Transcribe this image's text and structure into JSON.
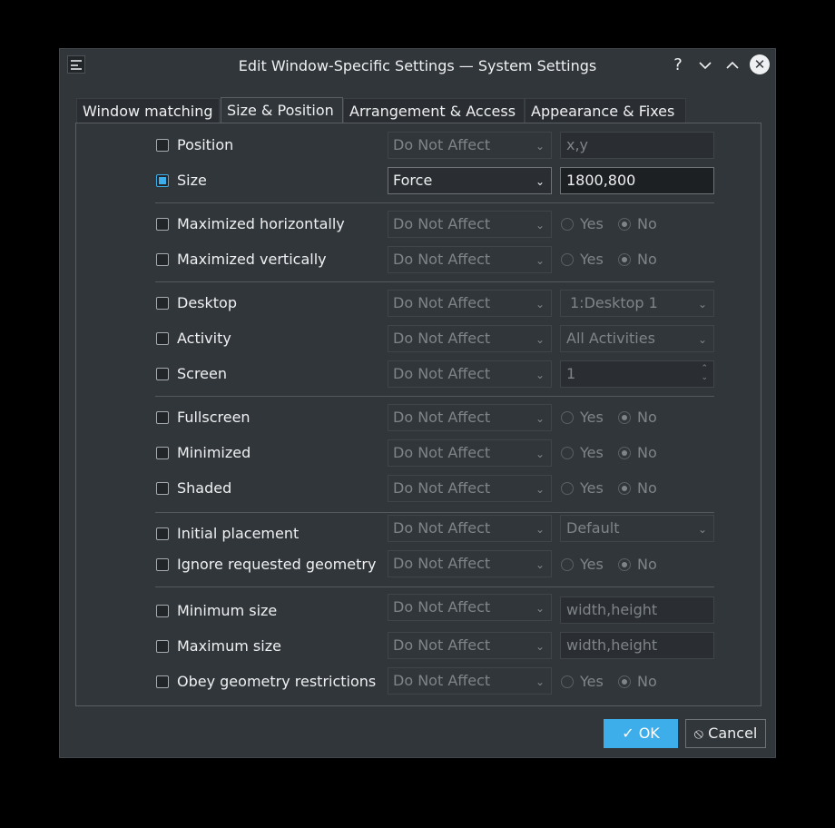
{
  "window": {
    "title": "Edit Window-Specific Settings — System Settings",
    "help_icon": "?",
    "minimize_icon": "chevron-down-icon",
    "maximize_icon": "chevron-up-icon",
    "close_icon": "close-icon"
  },
  "tabs": [
    "Window matching",
    "Size & Position",
    "Arrangement & Access",
    "Appearance & Fixes"
  ],
  "active_tab": "Size & Position",
  "rows": {
    "position": {
      "label": "Position",
      "checked": false,
      "policy": "Do Not Affect",
      "value": "x,y"
    },
    "size": {
      "label": "Size",
      "checked": true,
      "policy": "Force",
      "value": "1800,800"
    },
    "max_h": {
      "label": "Maximized horizontally",
      "checked": false,
      "policy": "Do Not Affect",
      "yes": "Yes",
      "no": "No"
    },
    "max_v": {
      "label": "Maximized vertically",
      "checked": false,
      "policy": "Do Not Affect",
      "yes": "Yes",
      "no": "No"
    },
    "desktop": {
      "label": "Desktop",
      "checked": false,
      "policy": "Do Not Affect",
      "value": "1:Desktop 1"
    },
    "activity": {
      "label": "Activity",
      "checked": false,
      "policy": "Do Not Affect",
      "value": "All Activities"
    },
    "screen": {
      "label": "Screen",
      "checked": false,
      "policy": "Do Not Affect",
      "value": "1"
    },
    "fullscreen": {
      "label": "Fullscreen",
      "checked": false,
      "policy": "Do Not Affect",
      "yes": "Yes",
      "no": "No"
    },
    "minimized": {
      "label": "Minimized",
      "checked": false,
      "policy": "Do Not Affect",
      "yes": "Yes",
      "no": "No"
    },
    "shaded": {
      "label": "Shaded",
      "checked": false,
      "policy": "Do Not Affect",
      "yes": "Yes",
      "no": "No"
    },
    "initial_placement": {
      "label": "Initial placement",
      "checked": false,
      "policy": "Do Not Affect",
      "value": "Default"
    },
    "ignore_geom": {
      "label": "Ignore requested geometry",
      "checked": false,
      "policy": "Do Not Affect",
      "yes": "Yes",
      "no": "No"
    },
    "min_size": {
      "label": "Minimum size",
      "checked": false,
      "policy": "Do Not Affect",
      "value": "width,height"
    },
    "max_size": {
      "label": "Maximum size",
      "checked": false,
      "policy": "Do Not Affect",
      "value": "width,height"
    },
    "obey_geom": {
      "label": "Obey geometry restrictions",
      "checked": false,
      "policy": "Do Not Affect",
      "yes": "Yes",
      "no": "No"
    }
  },
  "buttons": {
    "ok": "OK",
    "cancel": "Cancel"
  },
  "colors": {
    "accent": "#3daee9",
    "window_bg": "#31363b",
    "text": "#eff0f1",
    "disabled_text": "#7f8489"
  }
}
